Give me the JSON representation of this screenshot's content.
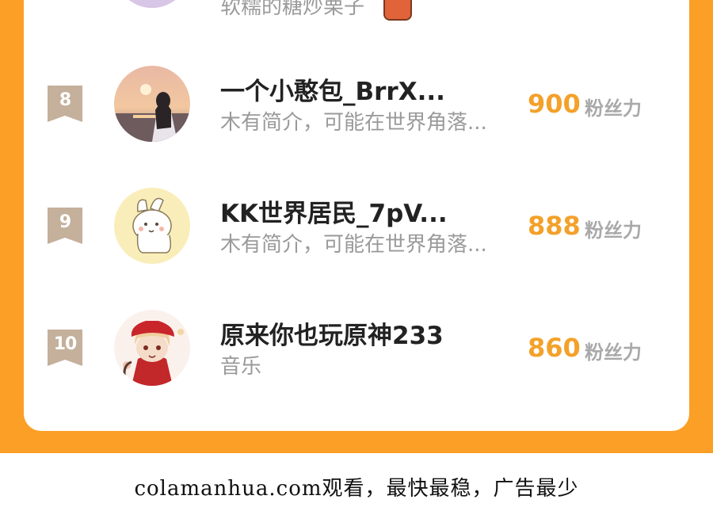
{
  "top_partial": {
    "desc": "软糯的糖炒栗子"
  },
  "ranking": [
    {
      "rank": "8",
      "name": "一个小憨包_BrrX...",
      "desc": "木有简介，可能在世界角落...",
      "score": "900",
      "unit": "粉丝力",
      "avatar_icon": "sunset-portrait-avatar"
    },
    {
      "rank": "9",
      "name": "KK世界居民_7pV...",
      "desc": "木有简介，可能在世界角落...",
      "score": "888",
      "unit": "粉丝力",
      "avatar_icon": "cartoon-dog-avatar"
    },
    {
      "rank": "10",
      "name": "原来你也玩原神233",
      "desc": "音乐",
      "score": "860",
      "unit": "粉丝力",
      "avatar_icon": "anime-girl-avatar"
    }
  ],
  "footer": {
    "text": "colamanhua.com观看，最快最稳，广告最少"
  },
  "colors": {
    "orange_bg": "#fb9f26",
    "score": "#f3a12a",
    "badge": "#c4b09b"
  }
}
